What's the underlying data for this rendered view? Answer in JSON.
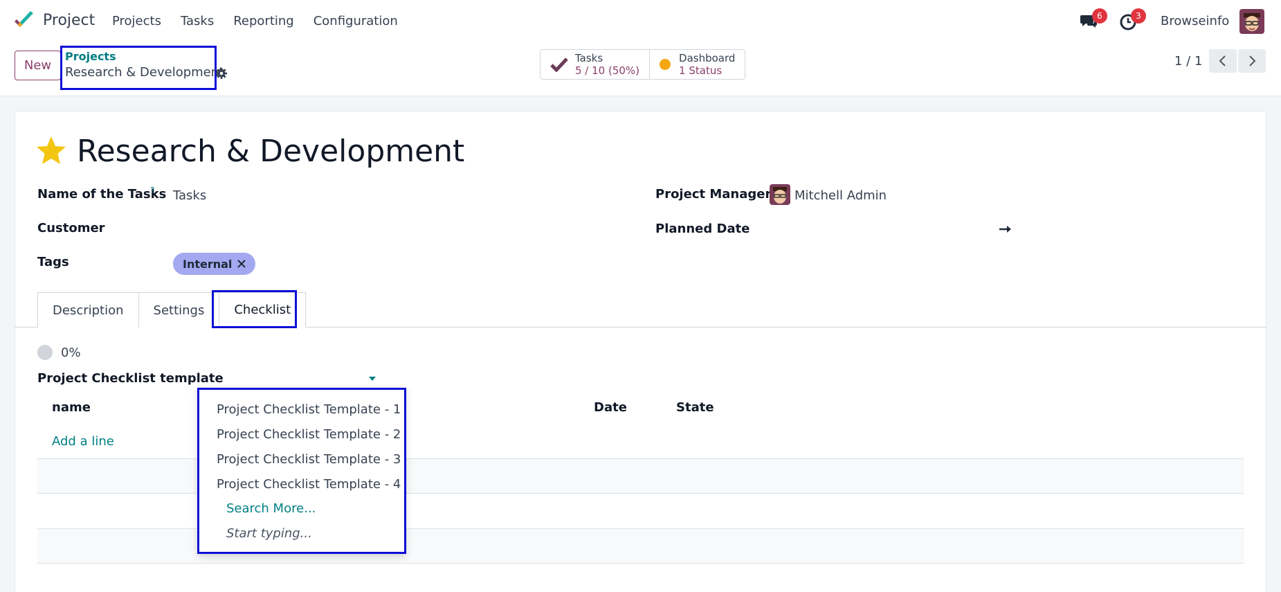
{
  "navbar": {
    "app_name": "Project",
    "menu": [
      "Projects",
      "Tasks",
      "Reporting",
      "Configuration"
    ],
    "messages_count": "6",
    "activities_count": "3",
    "user_name": "Browseinfo"
  },
  "control": {
    "new_label": "New",
    "breadcrumb_parent": "Projects",
    "breadcrumb_current": "Research & Development",
    "smart_buttons": [
      {
        "label": "Tasks",
        "value": "5 / 10 (50%)"
      },
      {
        "label": "Dashboard",
        "value": "1 Status"
      }
    ],
    "pager": "1 / 1"
  },
  "form": {
    "title": "Research & Development",
    "fields": {
      "name_of_tasks_label": "Name of the Tasks",
      "name_of_tasks_help": "?",
      "name_of_tasks_value": "Tasks",
      "customer_label": "Customer",
      "tags_label": "Tags",
      "tag_value": "Internal",
      "project_manager_label": "Project Manager",
      "project_manager_value": "Mitchell Admin",
      "planned_date_label": "Planned Date"
    },
    "tabs": [
      "Description",
      "Settings",
      "Checklist"
    ],
    "active_tab": "Checklist",
    "checklist": {
      "progress": "0%",
      "template_label": "Project Checklist template",
      "columns": [
        "name",
        "Date",
        "State"
      ],
      "add_line": "Add a line"
    }
  },
  "dropdown": {
    "options": [
      "Project Checklist Template - 1",
      "Project Checklist Template - 2",
      "Project Checklist Template - 3",
      "Project Checklist Template - 4"
    ],
    "search_more": "Search More...",
    "start_typing": "Start typing..."
  },
  "colors": {
    "brand": "#8b3f6b",
    "link": "#017e84",
    "highlight": "#0d0fd6",
    "badge": "#e0343f",
    "tag": "#a3a8f0",
    "star": "#f3c614"
  }
}
